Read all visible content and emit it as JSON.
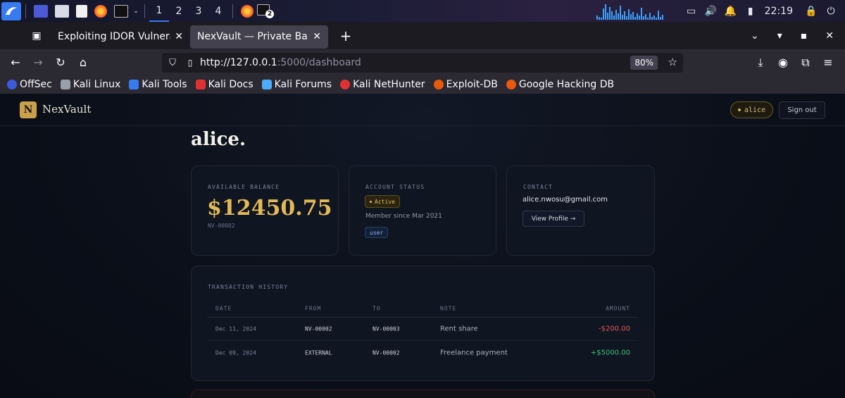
{
  "taskbar": {
    "workspaces": [
      "1",
      "2",
      "3",
      "4"
    ],
    "terminal_badge": "2",
    "clock": "22:19"
  },
  "browser": {
    "tabs": [
      {
        "label": "Exploiting IDOR Vulnerabilities",
        "active": false
      },
      {
        "label": "NexVault — Private Banking",
        "active": true
      }
    ],
    "url_host": "http://127.0.0.1",
    "url_path": ":5000/dashboard",
    "zoom": "80%",
    "bookmarks": [
      {
        "label": "OffSec",
        "icon": "offsec-icon",
        "color": "#3b5bdb"
      },
      {
        "label": "Kali Linux",
        "icon": "kali-dragon-icon",
        "color": "#9aa0aa"
      },
      {
        "label": "Kali Tools",
        "icon": "kali-tools-icon",
        "color": "#367bf0"
      },
      {
        "label": "Kali Docs",
        "icon": "kali-docs-icon",
        "color": "#e03131"
      },
      {
        "label": "Kali Forums",
        "icon": "kali-forums-icon",
        "color": "#4dabf7"
      },
      {
        "label": "Kali NetHunter",
        "icon": "nethunter-icon",
        "color": "#e03131"
      },
      {
        "label": "Exploit-DB",
        "icon": "exploit-db-icon",
        "color": "#e8590c"
      },
      {
        "label": "Google Hacking DB",
        "icon": "ghdb-icon",
        "color": "#e8590c"
      }
    ]
  },
  "site": {
    "logo_letter": "N",
    "brand": "NexVault",
    "user_chip": "alice",
    "signout_label": "Sign out",
    "welcome_name": "alice.",
    "balance_card": {
      "label": "AVAILABLE BALANCE",
      "amount": "$12450.75",
      "account_number": "NV-00002"
    },
    "status_card": {
      "label": "ACCOUNT STATUS",
      "status": "Active",
      "member_since": "Member since Mar 2021",
      "role": "user"
    },
    "contact_card": {
      "label": "CONTACT",
      "email": "alice.nwosu@gmail.com",
      "profile_button": "View Profile →"
    },
    "transactions": {
      "title": "TRANSACTION HISTORY",
      "columns": [
        "DATE",
        "FROM",
        "TO",
        "NOTE",
        "AMOUNT"
      ],
      "rows": [
        {
          "date": "Dec 11, 2024",
          "from": "NV-00002",
          "to": "NV-00003",
          "note": "Rent share",
          "amount": "-$200.00",
          "direction": "debit"
        },
        {
          "date": "Dec 09, 2024",
          "from": "EXTERNAL",
          "to": "NV-00002",
          "note": "Freelance payment",
          "amount": "+$5000.00",
          "direction": "credit"
        }
      ]
    }
  },
  "colors": {
    "accent_gold": "#e2b955",
    "debit": "#e0595a",
    "credit": "#3fbf7a",
    "page_bg": "#0b0f19"
  }
}
